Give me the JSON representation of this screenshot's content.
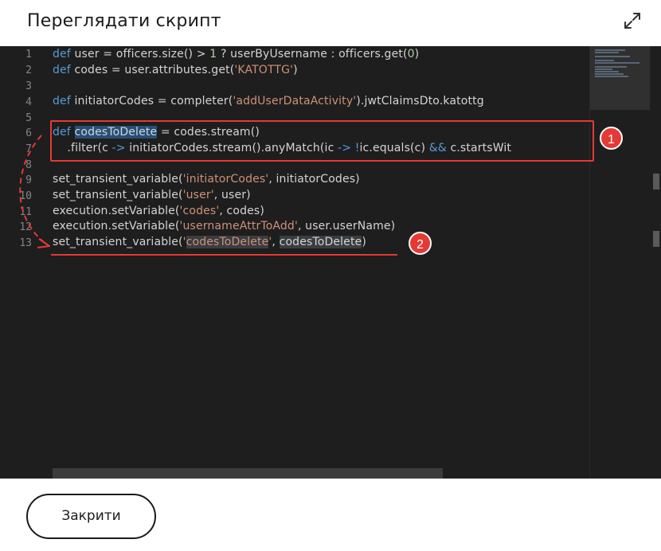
{
  "dialog": {
    "title": "Переглядати скрипт",
    "close_label": "Закрити"
  },
  "editor": {
    "lines": [
      {
        "no": "1"
      },
      {
        "no": "2"
      },
      {
        "no": "3"
      },
      {
        "no": "4"
      },
      {
        "no": "5"
      },
      {
        "no": "6"
      },
      {
        "no": "7"
      },
      {
        "no": "8"
      },
      {
        "no": "9"
      },
      {
        "no": "10"
      },
      {
        "no": "11"
      },
      {
        "no": "12"
      },
      {
        "no": "13"
      }
    ],
    "code": {
      "l1": {
        "kw": "def",
        "a": " user ",
        "op1": "=",
        "b": " officers.size() ",
        "op2": ">",
        "sp": " ",
        "num1": "1",
        "c": " ? userByUsername : officers.get(",
        "num2": "0",
        "d": ")"
      },
      "l2": {
        "kw": "def",
        "a": " codes ",
        "op": "=",
        "b": " user.attributes.get(",
        "str": "'KATOTTG'",
        "c": ")"
      },
      "l4": {
        "kw": "def",
        "a": " initiatorCodes ",
        "op": "=",
        "b": " completer(",
        "str": "'addUserDataActivity'",
        "c": ").jwtClaimsDto.katottg"
      },
      "l6": {
        "kw": "def",
        "sp": " ",
        "sel": "codesToDelete",
        "a": " ",
        "op": "=",
        "b": " codes.stream()"
      },
      "l7": {
        "a": "    .filter(c ",
        "op1": "->",
        "b": " initiatorCodes.stream().anyMatch(ic ",
        "op2": "->",
        "sp": " ",
        "op3": "!",
        "c": "ic.equals(c) ",
        "op4": "&&",
        "d": " c.startsWit"
      },
      "l9": {
        "a": "set_transient_variable(",
        "str": "'initiatorCodes'",
        "b": ", initiatorCodes)"
      },
      "l10": {
        "a": "set_transient_variable(",
        "str": "'user'",
        "b": ", user)"
      },
      "l11": {
        "a": "execution.setVariable(",
        "str": "'codes'",
        "b": ", codes)"
      },
      "l12": {
        "a": "execution.setVariable(",
        "str": "'usernameAttrToAdd'",
        "b": ", user.userName)"
      },
      "l13": {
        "a": "set_transient_variable(",
        "str_q1": "'",
        "str_hl": "codesToDelete",
        "str_q2": "'",
        "b": ", ",
        "hl": "codesToDelete",
        "c": ")"
      }
    }
  },
  "annotations": {
    "badge1": "1",
    "badge2": "2"
  },
  "colors": {
    "keyword": "#569cd6",
    "string": "#ce9178",
    "number": "#b5cea8",
    "annotation": "#e53935",
    "editor_bg": "#1e1e1e"
  },
  "icons": {
    "expand": "expand-diagonal-arrows-icon"
  }
}
